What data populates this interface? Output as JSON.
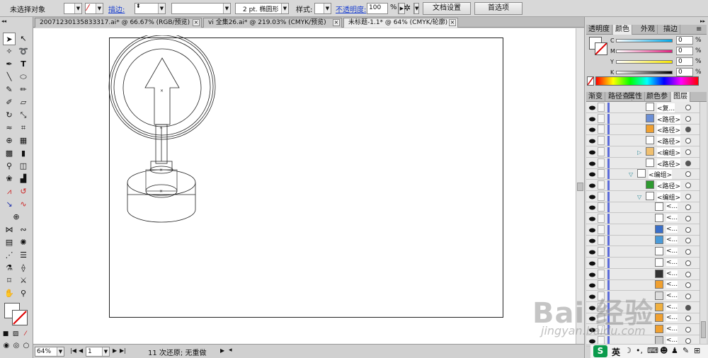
{
  "control_bar": {
    "selection_status": "未选择对象",
    "stroke_label": "描边:",
    "brush_text": "2 pt. 椭圆形",
    "style_label": "样式:",
    "opacity_label": "不透明度:",
    "opacity_value": "100",
    "opacity_unit": "%",
    "doc_setup_button": "文档设置",
    "preferences_button": "首选项"
  },
  "doc_tabs": [
    {
      "title": "20071230135833317.ai* @ 66.67% (RGB/预览)"
    },
    {
      "title": "vi 全集26.ai* @ 219.03% (CMYK/预览)"
    },
    {
      "title": "未标题-1.1* @ 64% (CMYK/轮廓)"
    }
  ],
  "color_panel": {
    "tabs": [
      "透明度",
      "颜色",
      "外观",
      "描边"
    ],
    "sliders": [
      {
        "name": "C",
        "value": "0",
        "unit": "%"
      },
      {
        "name": "M",
        "value": "0",
        "unit": "%"
      },
      {
        "name": "Y",
        "value": "0",
        "unit": "%"
      },
      {
        "name": "K",
        "value": "0",
        "unit": "%"
      }
    ]
  },
  "layers_panel": {
    "tabs": [
      "渐变",
      "路径查",
      "属性",
      "颜色参",
      "图层"
    ],
    "rows": [
      {
        "label": "<复...",
        "target": "empty"
      },
      {
        "label": "<路径>",
        "target": "empty"
      },
      {
        "label": "<路径>",
        "target": "filled"
      },
      {
        "label": "<路径>",
        "target": "empty"
      },
      {
        "label": "<编组>",
        "target": "empty"
      },
      {
        "label": "<路径>",
        "target": "filled"
      },
      {
        "label": "<编组>",
        "target": "empty"
      },
      {
        "label": "<路径>",
        "target": "empty"
      },
      {
        "label": "<编组>",
        "target": "empty"
      },
      {
        "label": "<...",
        "target": "empty"
      },
      {
        "label": "<...",
        "target": "empty"
      },
      {
        "label": "<...",
        "target": "empty"
      },
      {
        "label": "<...",
        "target": "empty"
      },
      {
        "label": "<...",
        "target": "empty"
      },
      {
        "label": "<...",
        "target": "empty"
      },
      {
        "label": "<...",
        "target": "empty"
      },
      {
        "label": "<...",
        "target": "empty"
      },
      {
        "label": "<...",
        "target": "empty"
      },
      {
        "label": "<...",
        "target": "filled"
      },
      {
        "label": "<...",
        "target": "empty"
      },
      {
        "label": "<...",
        "target": "empty"
      },
      {
        "label": "<...",
        "target": "empty"
      }
    ]
  },
  "status_bar": {
    "zoom": "64%",
    "artboard": "1",
    "history_text": "11 次还原; 无重做"
  },
  "ime_bar": {
    "logo": "S",
    "mode": "英"
  },
  "watermark": {
    "brand": "Bai 经验",
    "url": "jingyan.baidu.com"
  }
}
